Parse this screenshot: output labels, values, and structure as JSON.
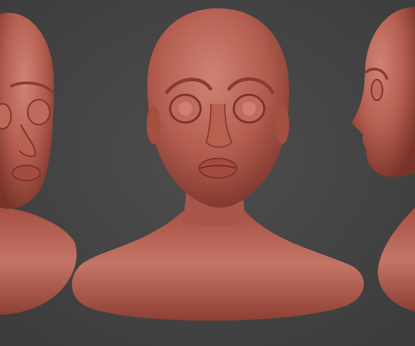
{
  "colors": {
    "background": "#454545",
    "skin": "#b35d4f",
    "skin_shadow": "#7a3329",
    "skin_highlight": "#d98a7a"
  },
  "views": [
    "three-quarter-left",
    "front",
    "profile-right"
  ]
}
